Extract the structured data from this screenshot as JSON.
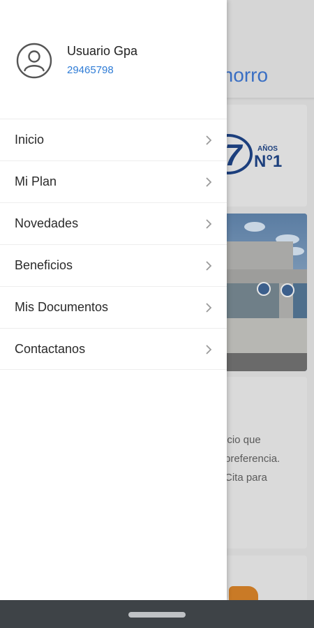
{
  "background": {
    "app_title_visible": "Ahorro",
    "logo_number": "7",
    "logo_years": "AÑOS",
    "logo_rank": "N°1",
    "text_lines": [
      "icio que",
      "preferencia.",
      "Cita para"
    ]
  },
  "drawer": {
    "user": {
      "name": "Usuario Gpa",
      "id": "29465798",
      "avatar_icon": "account-circle-icon"
    },
    "menu": [
      {
        "label": "Inicio",
        "icon": "chevron-right-icon"
      },
      {
        "label": "Mi Plan",
        "icon": "chevron-right-icon"
      },
      {
        "label": "Novedades",
        "icon": "chevron-right-icon"
      },
      {
        "label": "Beneficios",
        "icon": "chevron-right-icon"
      },
      {
        "label": "Mis Documentos",
        "icon": "chevron-right-icon"
      },
      {
        "label": "Contactanos",
        "icon": "chevron-right-icon"
      }
    ]
  },
  "colors": {
    "accent_blue": "#2f7cd6",
    "brand_navy": "#1c3f7d",
    "navbar": "#3e4347"
  }
}
